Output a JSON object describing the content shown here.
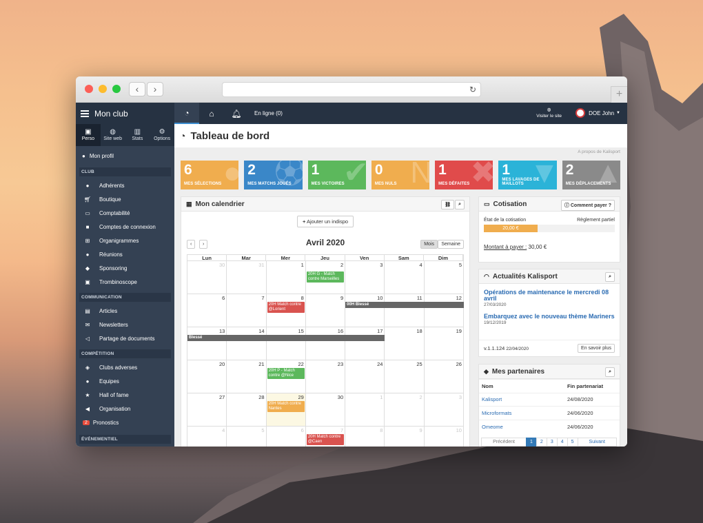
{
  "sidebar": {
    "title": "Mon club",
    "tabs": [
      {
        "label": "Perso",
        "icon": "id-card-icon"
      },
      {
        "label": "Site web",
        "icon": "globe-icon"
      },
      {
        "label": "Stats",
        "icon": "bar-chart-icon"
      },
      {
        "label": "Options",
        "icon": "gears-icon"
      }
    ],
    "profile": "Mon profil",
    "sections": {
      "club": "CLUB",
      "communication": "COMMUNICATION",
      "competition": "COMPÉTITION",
      "evenementiel": "ÉVÉNEMENTIEL"
    },
    "club_items": [
      "Adhérents",
      "Boutique",
      "Comptabilité",
      "Comptes de connexion",
      "Organigrammes",
      "Réunions",
      "Sponsoring",
      "Trombinoscope"
    ],
    "communication_items": [
      "Articles",
      "Newsletters",
      "Partage de documents"
    ],
    "competition_items": [
      "Clubs adverses",
      "Equipes",
      "Hall of fame",
      "Organisation",
      "Pronostics"
    ],
    "pronostics_badge": "2"
  },
  "topbar": {
    "online": "En ligne (0)",
    "visit": "Visiter le site",
    "user": "DOE John"
  },
  "page": {
    "title": "Tableau de bord",
    "apropos": "A propos de Kalisport"
  },
  "tiles": [
    {
      "num": "6",
      "label": "MES SÉLECTIONS",
      "color": "#f0ad4e"
    },
    {
      "num": "2",
      "label": "MES MATCHS JOUÉS",
      "color": "#3a87c8"
    },
    {
      "num": "1",
      "label": "MES VICTOIRES",
      "color": "#5cb85c"
    },
    {
      "num": "0",
      "label": "MES NULS",
      "color": "#f0ad4e"
    },
    {
      "num": "1",
      "label": "MES DÉFAITES",
      "color": "#e04b4b"
    },
    {
      "num": "1",
      "label": "MES LAVAGES DE MAILLOTS",
      "color": "#2bb3d8"
    },
    {
      "num": "2",
      "label": "MES DÉPLACEMENTS",
      "color": "#8a8a8a"
    }
  ],
  "calendar": {
    "title": "Mon calendrier",
    "add_btn": "Ajouter un indispo",
    "month": "Avril 2020",
    "view_month": "Mois",
    "view_week": "Semaine",
    "days": [
      "Lun",
      "Mar",
      "Mer",
      "Jeu",
      "Ven",
      "Sam",
      "Dim"
    ],
    "cells": [
      "30",
      "31",
      "1",
      "2",
      "3",
      "4",
      "5",
      "6",
      "7",
      "8",
      "9",
      "10",
      "11",
      "12",
      "13",
      "14",
      "15",
      "16",
      "17",
      "18",
      "19",
      "20",
      "21",
      "22",
      "23",
      "24",
      "25",
      "26",
      "27",
      "28",
      "29",
      "30",
      "1",
      "2",
      "3",
      "4",
      "5",
      "6",
      "7",
      "8",
      "9",
      "10"
    ],
    "events": {
      "e1": "20H G - Match contre Marseilles",
      "e2": "20H Match contre @Lorient",
      "e3": "20H P - Match contre @Nice",
      "e4": "20H Match contre Nantes",
      "e5": "20H Match contre @Caen",
      "bar1": "00H Blessé",
      "bar2": "Blessé"
    }
  },
  "cotisation": {
    "title": "Cotisation",
    "help_btn": "Comment payer ?",
    "state_label": "État de la cotisation",
    "state_value": "Règlement partiel",
    "amount": "20,00 €",
    "progress": 0.41,
    "due_label": "Montant à payer :",
    "due_value": "30,00 €"
  },
  "news": {
    "title": "Actualités Kalisport",
    "items": [
      {
        "title": "Opérations de maintenance le mercredi 08 avril",
        "date": "27/03/2020"
      },
      {
        "title": "Embarquez avec le nouveau thème Mariners",
        "date": "19/12/2019"
      }
    ],
    "version": "v.1.1.124",
    "version_date": "22/04/2020",
    "more_btn": "En savoir plus"
  },
  "partners": {
    "title": "Mes partenaires",
    "col_name": "Nom",
    "col_end": "Fin partenariat",
    "rows": [
      {
        "name": "Kalisport",
        "end": "24/08/2020"
      },
      {
        "name": "Microformats",
        "end": "24/06/2020"
      },
      {
        "name": "Omeome",
        "end": "24/06/2020"
      }
    ],
    "prev": "Précédent",
    "pages": [
      "1",
      "2",
      "3",
      "4",
      "5"
    ],
    "next": "Suivant"
  }
}
